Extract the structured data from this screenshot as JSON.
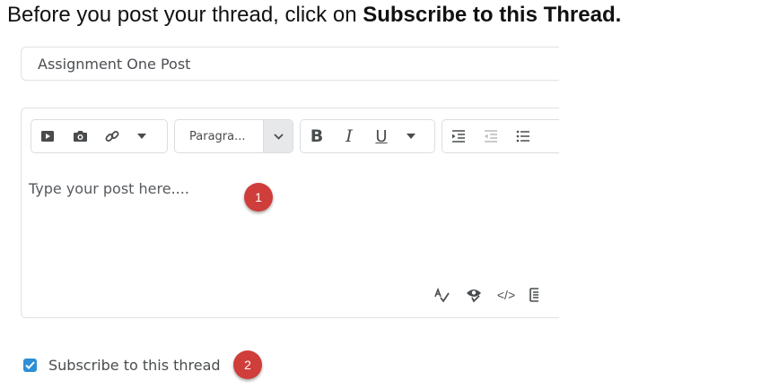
{
  "instruction": {
    "text": "Before you post your thread, click on ",
    "emphasis": "Subscribe to this Thread."
  },
  "title_input": {
    "value": "Assignment One Post"
  },
  "toolbar": {
    "insert_group": [
      "video-icon",
      "camera-icon",
      "link-icon",
      "caret-down-icon"
    ],
    "format_select": {
      "value": "Paragra..."
    },
    "text_style": {
      "bold": "B",
      "italic": "I",
      "underline": "U"
    },
    "list_group": [
      "indent-icon",
      "outdent-icon",
      "bulleted-list-icon"
    ]
  },
  "editor": {
    "placeholder": "Type your post here....",
    "bottom_tools": [
      "spellcheck-icon",
      "accessibility-checker-icon",
      "source-code-icon",
      "fullscreen-icon"
    ],
    "source_code_glyph": "</>"
  },
  "subscribe": {
    "label": "Subscribe to this thread",
    "checked": true
  },
  "badges": {
    "first": "1",
    "second": "2"
  },
  "colors": {
    "badge": "#cf3e3a",
    "checkbox": "#2d8fd5",
    "border": "#dfe1e4"
  }
}
